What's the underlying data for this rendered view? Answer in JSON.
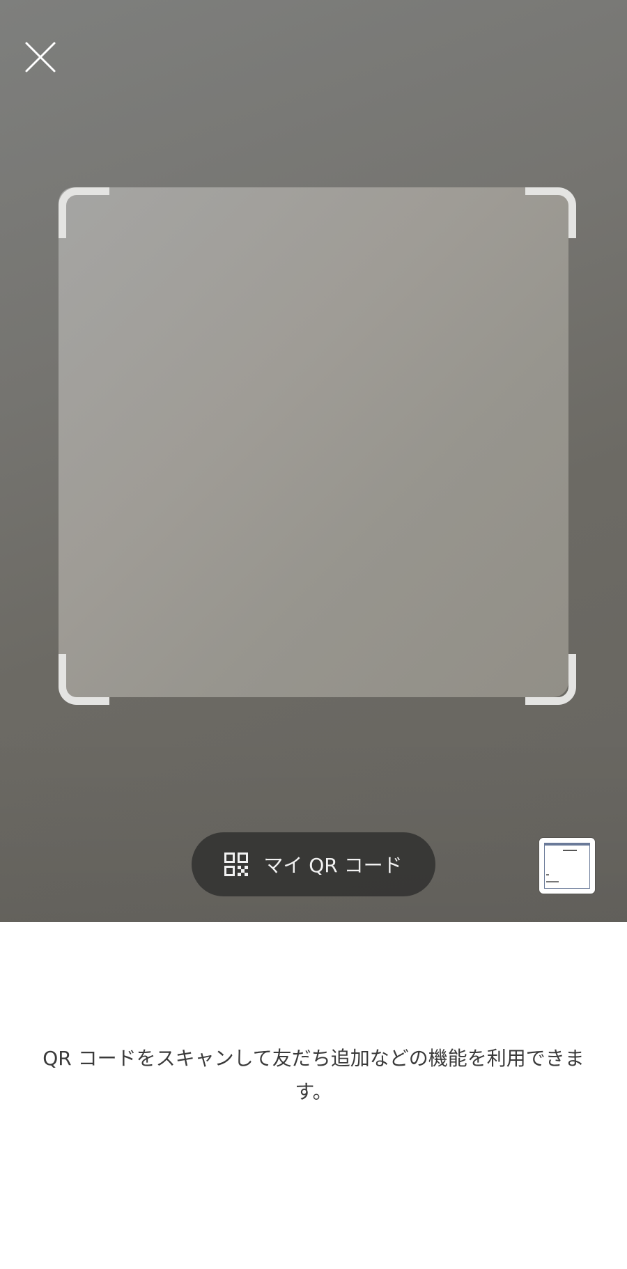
{
  "scanner": {
    "my_qr_label": "マイ QR コード",
    "description": "QR コードをスキャンして友だち追加などの機能を利用できます。"
  },
  "icons": {
    "close": "close-icon",
    "qr": "qr-code-icon",
    "gallery": "gallery-thumbnail"
  },
  "colors": {
    "camera_bg": "#727170",
    "button_bg": "#343433",
    "frame_corner": "#e4e4e2",
    "text": "#3a3a3a"
  }
}
